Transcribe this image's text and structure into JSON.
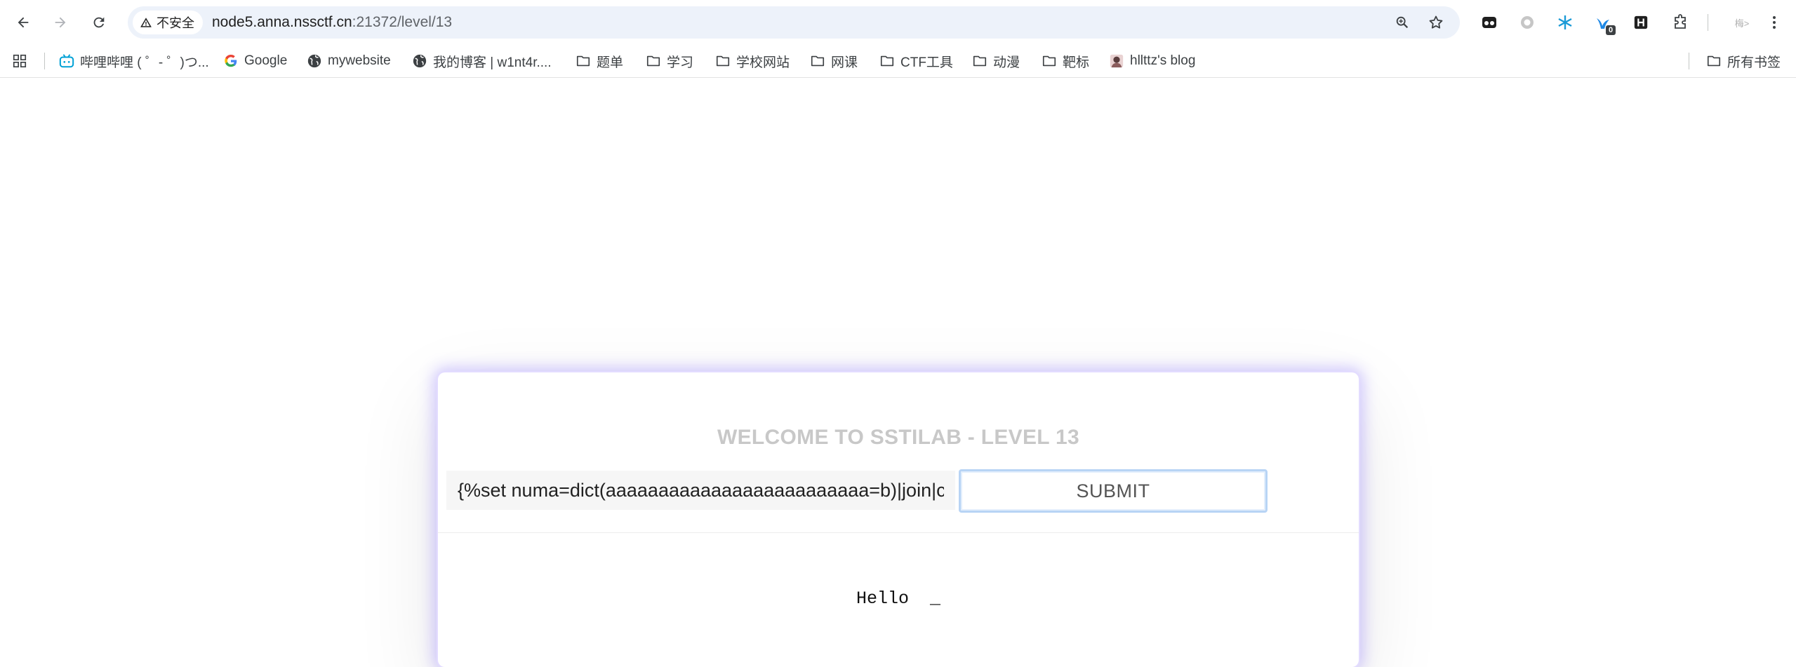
{
  "browser": {
    "security_label": "不安全",
    "url_host": "node5.anna.nssctf.cn",
    "url_rest": ":21372/level/13",
    "extension_badge": "0",
    "profile_label": "梅>"
  },
  "bookmarks": [
    {
      "label": "哔哩哔哩 ( ゜- ゜)つ...",
      "icon": "bilibili-icon"
    },
    {
      "label": "Google",
      "icon": "google-icon"
    },
    {
      "label": "mywebsite",
      "icon": "globe-icon"
    },
    {
      "label": "我的博客 | w1nt4r....",
      "icon": "globe-icon"
    },
    {
      "label": "题单",
      "icon": "folder-icon"
    },
    {
      "label": "学习",
      "icon": "folder-icon"
    },
    {
      "label": "学校网站",
      "icon": "folder-icon"
    },
    {
      "label": "网课",
      "icon": "folder-icon"
    },
    {
      "label": "CTF工具",
      "icon": "folder-icon"
    },
    {
      "label": "动漫",
      "icon": "folder-icon"
    },
    {
      "label": "靶标",
      "icon": "folder-icon"
    },
    {
      "label": "hllttz's blog",
      "icon": "avatar-icon"
    }
  ],
  "all_bookmarks_label": "所有书签",
  "page": {
    "title": "WELCOME TO SSTILAB - LEVEL 13",
    "input_value": "{%set numa=dict(aaaaaaaaaaaaaaaaaaaaaaaaa=b)|join|co",
    "submit_label": "SUBMIT",
    "output_text": "Hello  _"
  },
  "colors": {
    "omnibox_bg": "#edf2fa",
    "card_glow": "#9682ff",
    "title_color": "#c8c8c8",
    "submit_border": "#b8d4f5"
  }
}
